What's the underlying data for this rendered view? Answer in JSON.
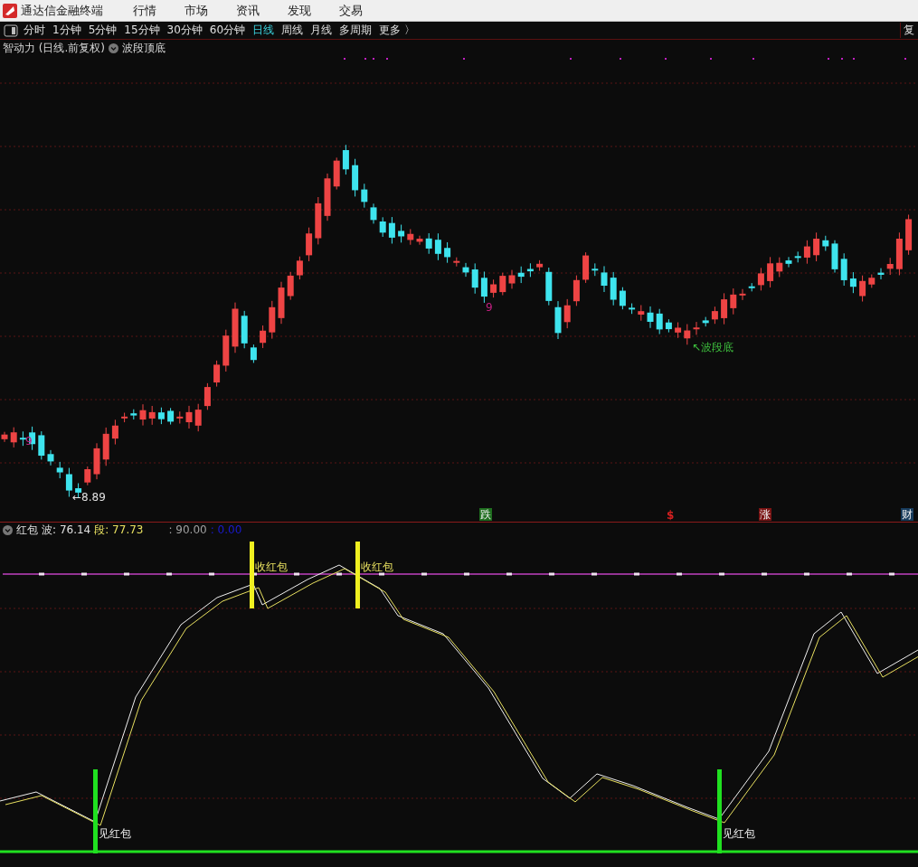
{
  "menu_bar": {
    "app_title": "通达信金融终端",
    "items": [
      {
        "label": "行情"
      },
      {
        "label": "市场"
      },
      {
        "label": "资讯"
      },
      {
        "label": "发现"
      },
      {
        "label": "交易"
      }
    ]
  },
  "period_bar": {
    "periods": [
      {
        "label": "分时",
        "selected": false
      },
      {
        "label": "1分钟",
        "selected": false
      },
      {
        "label": "5分钟",
        "selected": false
      },
      {
        "label": "15分钟",
        "selected": false
      },
      {
        "label": "30分钟",
        "selected": false
      },
      {
        "label": "60分钟",
        "selected": false
      },
      {
        "label": "日线",
        "selected": true
      },
      {
        "label": "周线",
        "selected": false
      },
      {
        "label": "月线",
        "selected": false
      },
      {
        "label": "多周期",
        "selected": false
      },
      {
        "label": "更多 〉",
        "selected": false
      }
    ],
    "right_button": "复"
  },
  "main_chart": {
    "title": "智动力 (日线.前复权)",
    "indicator": "波段顶底",
    "annotations": [
      {
        "kind": "count",
        "text": "9"
      },
      {
        "kind": "count",
        "text": "9"
      },
      {
        "kind": "low",
        "text": "←8.89"
      },
      {
        "kind": "signal",
        "text": "↖波段底"
      }
    ],
    "event_markers": [
      {
        "kind": "box",
        "text": "跌",
        "color": "#1f6e1f"
      },
      {
        "kind": "plain",
        "text": "$",
        "color": "#d42020"
      },
      {
        "kind": "box",
        "text": "涨",
        "color": "#7a1414"
      },
      {
        "kind": "box",
        "text": "财",
        "color": "#173b5c"
      }
    ]
  },
  "indicator_panel": {
    "name": "红包",
    "readings": [
      {
        "label": "波:",
        "value": "76.14",
        "color": "#e0e0e0"
      },
      {
        "label": "段:",
        "value": "77.73",
        "color": "#e8e060"
      },
      {
        "label": ":",
        "value": "90.00",
        "color": "#a0a0a0"
      },
      {
        "label": ":",
        "value": "0.00",
        "color": "#1a1ad0"
      }
    ],
    "signals": [
      {
        "kind": "buy",
        "text": "见红包"
      },
      {
        "kind": "sell",
        "text": "收红包"
      },
      {
        "kind": "sell",
        "text": "收红包"
      },
      {
        "kind": "buy",
        "text": "见红包"
      }
    ]
  }
}
